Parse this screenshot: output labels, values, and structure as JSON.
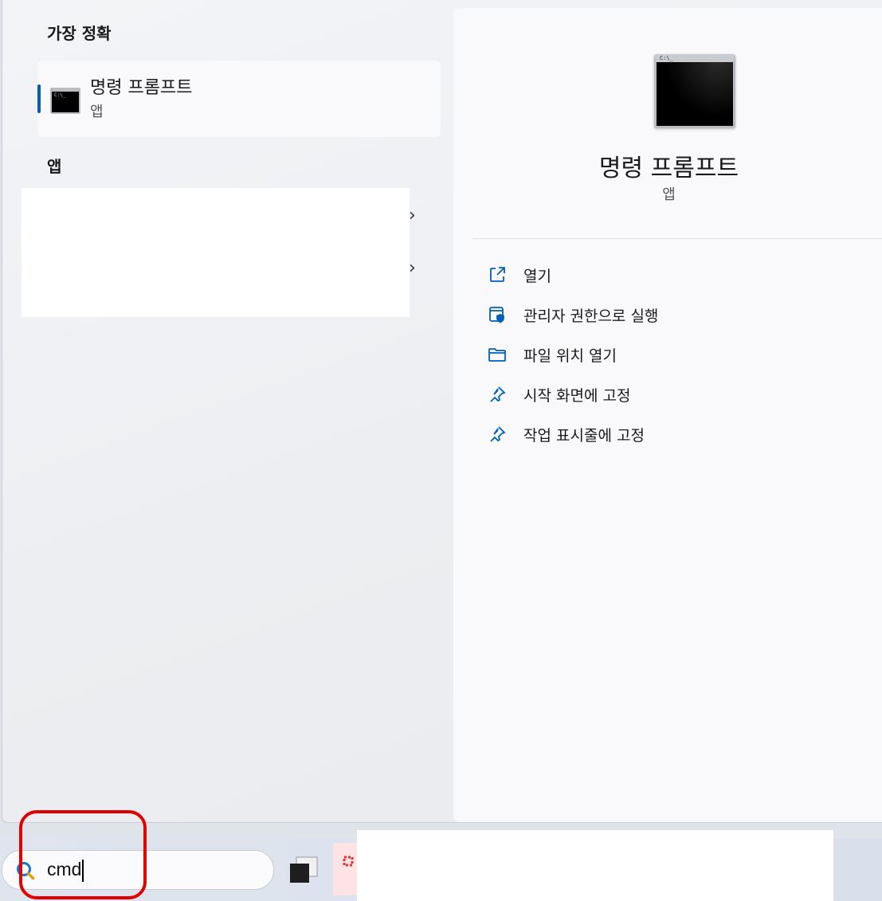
{
  "left": {
    "best_match_title": "가장 정확",
    "best_match": {
      "name": "명령 프롬프트",
      "type": "앱"
    },
    "apps_title": "앱"
  },
  "right": {
    "app_name": "명령 프롬프트",
    "app_type": "앱",
    "actions": [
      {
        "label": "열기",
        "icon": "open-external-icon"
      },
      {
        "label": "관리자 권한으로 실행",
        "icon": "shield-admin-icon"
      },
      {
        "label": "파일 위치 열기",
        "icon": "folder-icon"
      },
      {
        "label": "시작 화면에 고정",
        "icon": "pin-icon"
      },
      {
        "label": "작업 표시줄에 고정",
        "icon": "pin-icon"
      }
    ]
  },
  "taskbar": {
    "search_value": "cmd"
  },
  "colors": {
    "accent": "#005fb8",
    "highlight": "#e00000"
  }
}
